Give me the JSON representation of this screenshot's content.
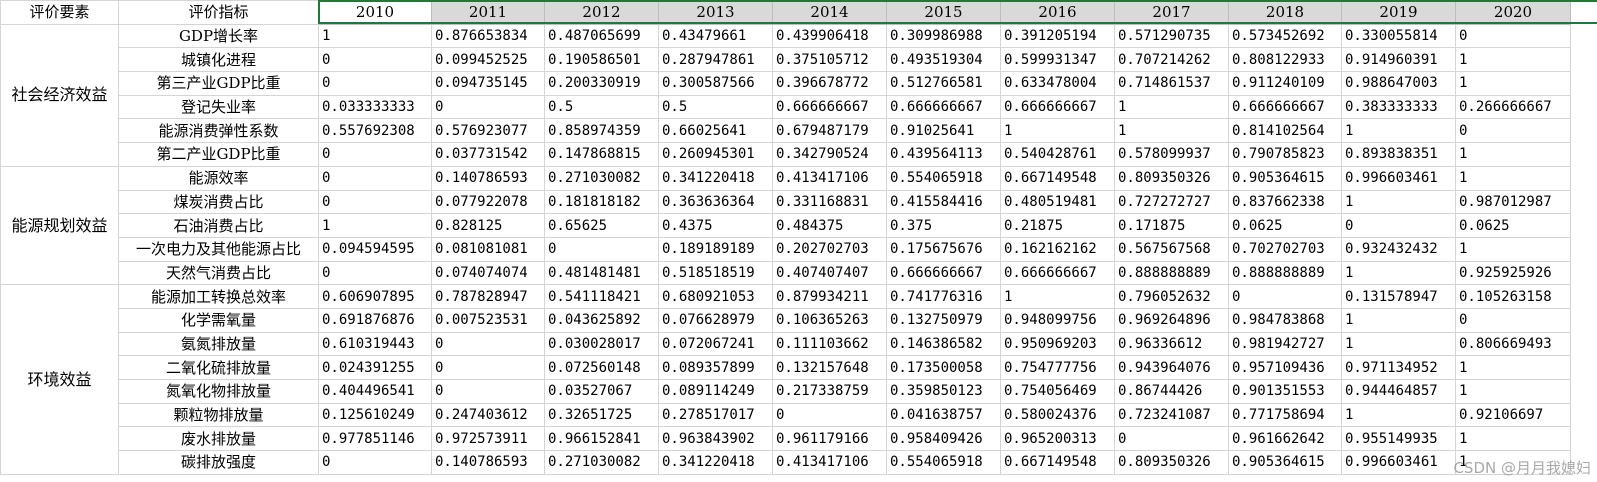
{
  "header": {
    "factor": "评价要素",
    "indicator": "评价指标",
    "years": [
      "2010",
      "2011",
      "2012",
      "2013",
      "2014",
      "2015",
      "2016",
      "2017",
      "2018",
      "2019",
      "2020"
    ]
  },
  "groups": [
    {
      "name": "社会经济效益",
      "rows": [
        {
          "indicator": "GDP增长率",
          "values": [
            "1",
            "0.876653834",
            "0.487065699",
            "0.43479661",
            "0.439906418",
            "0.309986988",
            "0.391205194",
            "0.571290735",
            "0.573452692",
            "0.330055814",
            "0"
          ]
        },
        {
          "indicator": "城镇化进程",
          "values": [
            "0",
            "0.099452525",
            "0.190586501",
            "0.287947861",
            "0.375105712",
            "0.493519304",
            "0.599931347",
            "0.707214262",
            "0.808122933",
            "0.914960391",
            "1"
          ]
        },
        {
          "indicator": "第三产业GDP比重",
          "values": [
            "0",
            "0.094735145",
            "0.200330919",
            "0.300587566",
            "0.396678772",
            "0.512766581",
            "0.633478004",
            "0.714861537",
            "0.911240109",
            "0.988647003",
            "1"
          ]
        },
        {
          "indicator": "登记失业率",
          "values": [
            "0.033333333",
            "0",
            "0.5",
            "0.5",
            "0.666666667",
            "0.666666667",
            "0.666666667",
            "1",
            "0.666666667",
            "0.383333333",
            "0.266666667"
          ]
        },
        {
          "indicator": "能源消费弹性系数",
          "values": [
            "0.557692308",
            "0.576923077",
            "0.858974359",
            "0.66025641",
            "0.679487179",
            "0.91025641",
            "1",
            "1",
            "0.814102564",
            "1",
            "0"
          ]
        },
        {
          "indicator": "第二产业GDP比重",
          "values": [
            "0",
            "0.037731542",
            "0.147868815",
            "0.260945301",
            "0.342790524",
            "0.439564113",
            "0.540428761",
            "0.578099937",
            "0.790785823",
            "0.893838351",
            "1"
          ]
        }
      ]
    },
    {
      "name": "能源规划效益",
      "rows": [
        {
          "indicator": "能源效率",
          "values": [
            "0",
            "0.140786593",
            "0.271030082",
            "0.341220418",
            "0.413417106",
            "0.554065918",
            "0.667149548",
            "0.809350326",
            "0.905364615",
            "0.996603461",
            "1"
          ]
        },
        {
          "indicator": "煤炭消费占比",
          "values": [
            "0",
            "0.077922078",
            "0.181818182",
            "0.363636364",
            "0.331168831",
            "0.415584416",
            "0.480519481",
            "0.727272727",
            "0.837662338",
            "1",
            "0.987012987"
          ]
        },
        {
          "indicator": "石油消费占比",
          "values": [
            "1",
            "0.828125",
            "0.65625",
            "0.4375",
            "0.484375",
            "0.375",
            "0.21875",
            "0.171875",
            "0.0625",
            "0",
            "0.0625"
          ]
        },
        {
          "indicator": "一次电力及其他能源占比",
          "values": [
            "0.094594595",
            "0.081081081",
            "0",
            "0.189189189",
            "0.202702703",
            "0.175675676",
            "0.162162162",
            "0.567567568",
            "0.702702703",
            "0.932432432",
            "1"
          ]
        },
        {
          "indicator": "天然气消费占比",
          "values": [
            "0",
            "0.074074074",
            "0.481481481",
            "0.518518519",
            "0.407407407",
            "0.666666667",
            "0.666666667",
            "0.888888889",
            "0.888888889",
            "1",
            "0.925925926"
          ]
        }
      ]
    },
    {
      "name": "环境效益",
      "rows": [
        {
          "indicator": "能源加工转换总效率",
          "values": [
            "0.606907895",
            "0.787828947",
            "0.541118421",
            "0.680921053",
            "0.879934211",
            "0.741776316",
            "1",
            "0.796052632",
            "0",
            "0.131578947",
            "0.105263158"
          ]
        },
        {
          "indicator": "化学需氧量",
          "values": [
            "0.691876876",
            "0.007523531",
            "0.043625892",
            "0.076628979",
            "0.106365263",
            "0.132750979",
            "0.948099756",
            "0.969264896",
            "0.984783868",
            "1",
            "0"
          ]
        },
        {
          "indicator": "氨氮排放量",
          "values": [
            "0.610319443",
            "0",
            "0.030028017",
            "0.072067241",
            "0.111103662",
            "0.146386582",
            "0.950969203",
            "0.96336612",
            "0.981942727",
            "1",
            "0.806669493"
          ]
        },
        {
          "indicator": "二氧化硫排放量",
          "values": [
            "0.024391255",
            "0",
            "0.072560148",
            "0.089357899",
            "0.132157648",
            "0.173500058",
            "0.754777756",
            "0.943964076",
            "0.957109436",
            "0.971134952",
            "1"
          ]
        },
        {
          "indicator": "氮氧化物排放量",
          "values": [
            "0.404496541",
            "0",
            "0.03527067",
            "0.089114249",
            "0.217338759",
            "0.359850123",
            "0.754056469",
            "0.86744426",
            "0.901351553",
            "0.944464857",
            "1"
          ]
        },
        {
          "indicator": "颗粒物排放量",
          "values": [
            "0.125610249",
            "0.247403612",
            "0.32651725",
            "0.278517017",
            "0",
            "0.041638757",
            "0.580024376",
            "0.723241087",
            "0.771758694",
            "1",
            "0.92106697"
          ]
        },
        {
          "indicator": "废水排放量",
          "values": [
            "0.977851146",
            "0.972573911",
            "0.966152841",
            "0.963843902",
            "0.961179166",
            "0.958409426",
            "0.965200313",
            "0",
            "0.961662642",
            "0.955149935",
            "1"
          ]
        },
        {
          "indicator": "碳排放强度",
          "values": [
            "0",
            "0.140786593",
            "0.271030082",
            "0.341220418",
            "0.413417106",
            "0.554065918",
            "0.667149548",
            "0.809350326",
            "0.905364615",
            "0.996603461",
            "1"
          ]
        }
      ]
    }
  ],
  "watermark": "CSDN @月月我媳妇"
}
